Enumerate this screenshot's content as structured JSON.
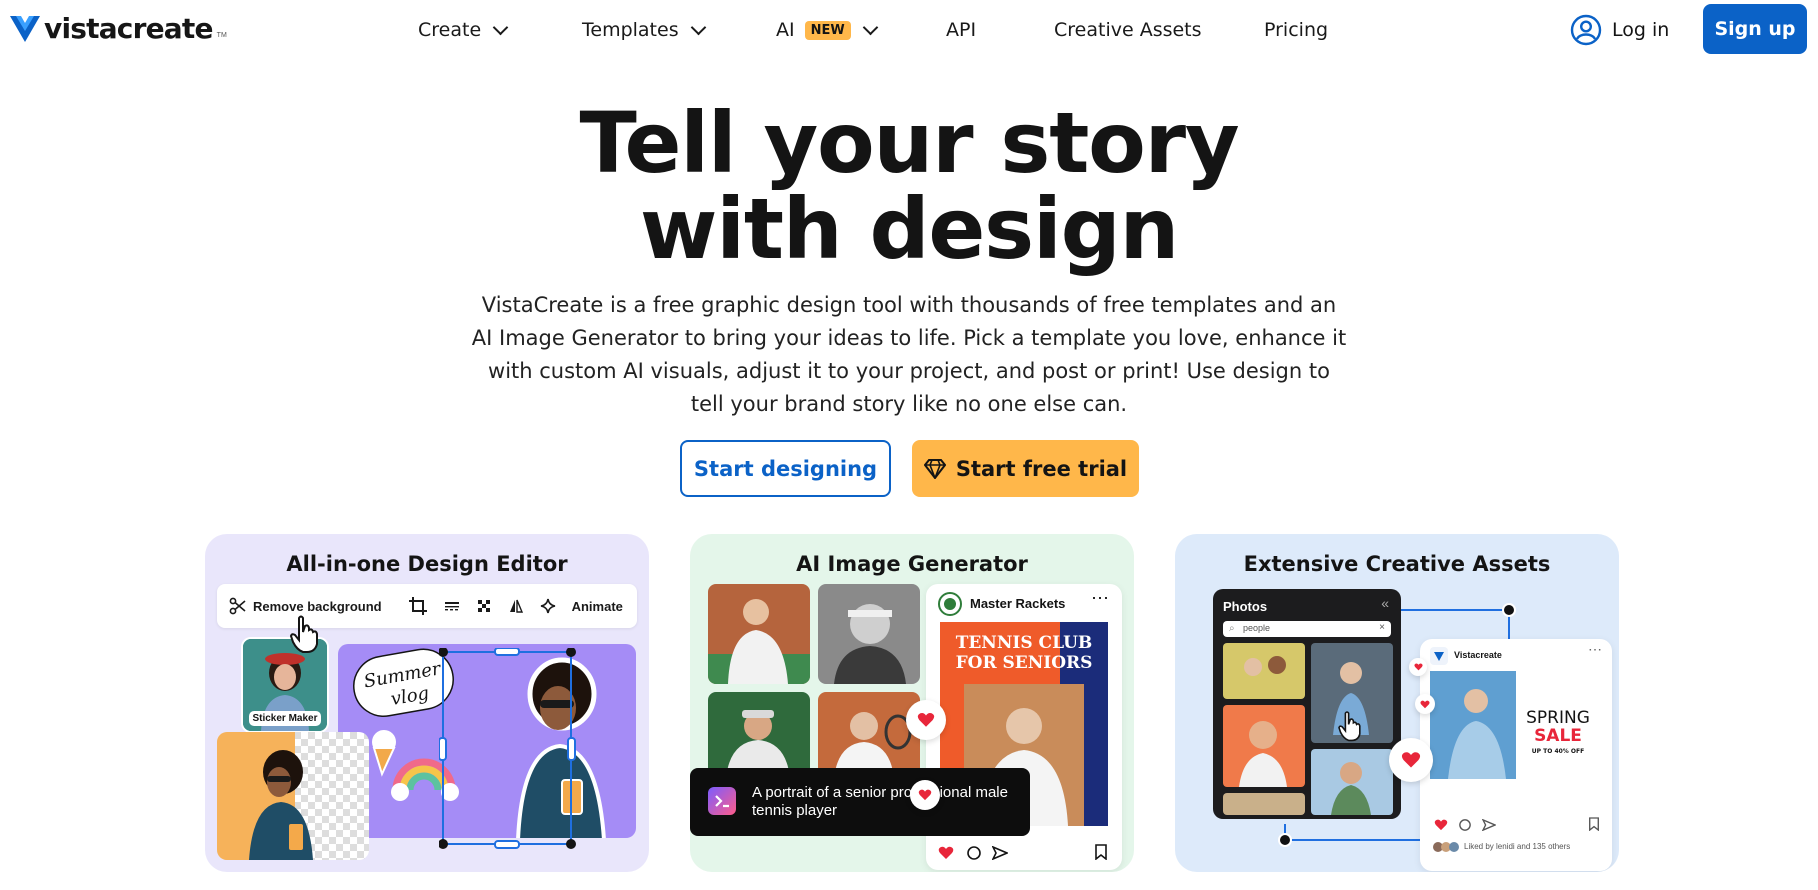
{
  "header": {
    "logo": {
      "text": "vistacreate",
      "tm": "TM"
    },
    "nav": [
      {
        "label": "Create",
        "has_dropdown": true
      },
      {
        "label": "Templates",
        "has_dropdown": true
      },
      {
        "label": "AI",
        "badge": "NEW",
        "has_dropdown": true
      },
      {
        "label": "API",
        "has_dropdown": false
      },
      {
        "label": "Creative Assets",
        "has_dropdown": false
      },
      {
        "label": "Pricing",
        "has_dropdown": false
      }
    ],
    "login_label": "Log in",
    "signup_label": "Sign up"
  },
  "hero": {
    "title_line1": "Tell your story",
    "title_line2": "with design",
    "description": "VistaCreate is a free graphic design tool with thousands of free templates and an AI Image Generator to bring your ideas to life. Pick a template you love, enhance it with custom AI visuals, adjust it to your project, and post or print! Use design to tell your brand story like no one else can.",
    "cta_primary": "Start designing",
    "cta_trial": "Start free trial"
  },
  "cards": {
    "editor": {
      "title": "All-in-one Design Editor",
      "toolbar": {
        "remove_bg": "Remove background",
        "animate": "Animate"
      },
      "sticker_label": "Sticker Maker",
      "sticker_text": "Summer vlog"
    },
    "ai": {
      "title": "AI Image Generator",
      "post_account": "Master Rackets",
      "poster_line1": "TENNIS CLUB",
      "poster_line2": "FOR SENIORS",
      "prompt": "A portrait of a senior professional male tennis player"
    },
    "assets": {
      "title": "Extensive Creative Assets",
      "panel_title": "Photos",
      "search_value": "people",
      "post_account": "Vistacreate",
      "sale_line1": "SPRING",
      "sale_line2": "SALE",
      "sale_sub": "UP TO 40% OFF",
      "liked_by": "Liked by lenidi and 135 others"
    }
  },
  "colors": {
    "brand_blue": "#0b62c7",
    "trial_orange": "#ffb74a",
    "card_editor_bg": "#e9e6fb",
    "card_ai_bg": "#e4f6ea",
    "card_assets_bg": "#ddeafa"
  }
}
